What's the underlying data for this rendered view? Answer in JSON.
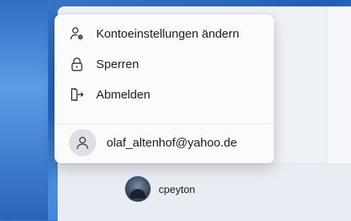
{
  "menu": {
    "items": [
      {
        "label": "Kontoeinstellungen ändern",
        "icon": "account-settings-icon"
      },
      {
        "label": "Sperren",
        "icon": "lock-icon"
      },
      {
        "label": "Abmelden",
        "icon": "sign-out-icon"
      }
    ],
    "account_email": "olaf_altenhof@yahoo.de"
  },
  "user": {
    "name": "cpeyton"
  }
}
